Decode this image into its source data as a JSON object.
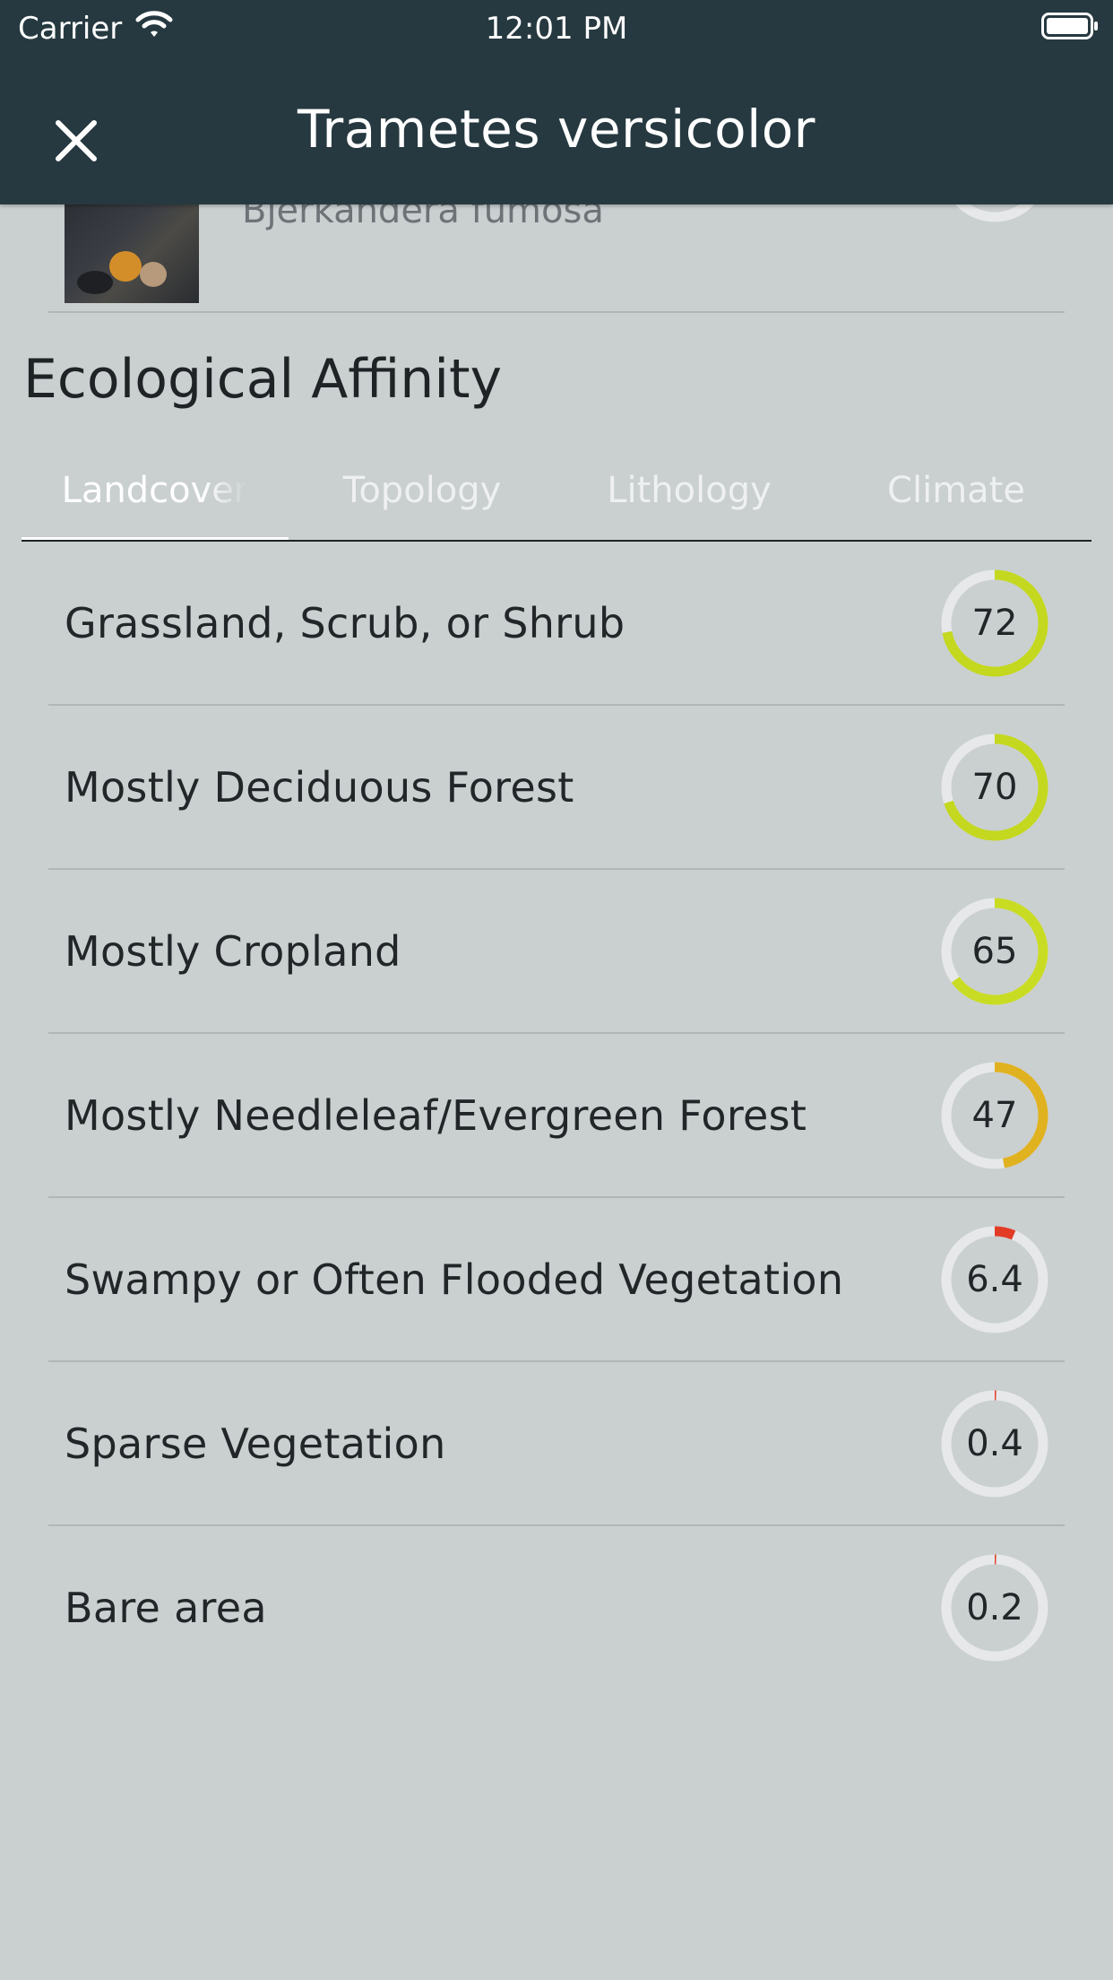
{
  "status_bar": {
    "carrier": "Carrier",
    "time": "12:01 PM"
  },
  "header": {
    "title": "Trametes versicolor"
  },
  "previous_item": {
    "name": "Bjerkandera fumosa"
  },
  "section": {
    "title": "Ecological Affinity"
  },
  "tabs": [
    {
      "label": "Landcover",
      "active": true
    },
    {
      "label": "Topology",
      "active": false
    },
    {
      "label": "Lithology",
      "active": false
    },
    {
      "label": "Climate",
      "active": false
    }
  ],
  "affinity_items": [
    {
      "label": "Grassland, Scrub, or Shrub",
      "value": "72",
      "percent": 72,
      "color": "#c3d81e"
    },
    {
      "label": "Mostly Deciduous Forest",
      "value": "70",
      "percent": 70,
      "color": "#c3d81e"
    },
    {
      "label": "Mostly Cropland",
      "value": "65",
      "percent": 65,
      "color": "#c9dc24"
    },
    {
      "label": "Mostly Needleleaf/Evergreen Forest",
      "value": "47",
      "percent": 47,
      "color": "#e1b21f"
    },
    {
      "label": "Swampy or Often Flooded Vegetation",
      "value": "6.4",
      "percent": 6.4,
      "color": "#e23b26"
    },
    {
      "label": "Sparse Vegetation",
      "value": "0.4",
      "percent": 0.4,
      "color": "#e23b26"
    },
    {
      "label": "Bare area",
      "value": "0.2",
      "percent": 0.2,
      "color": "#e23b26"
    }
  ],
  "colors": {
    "nav_background": "#263940",
    "page_background": "#cacfd0",
    "ring_track": "#e6e8e9"
  }
}
